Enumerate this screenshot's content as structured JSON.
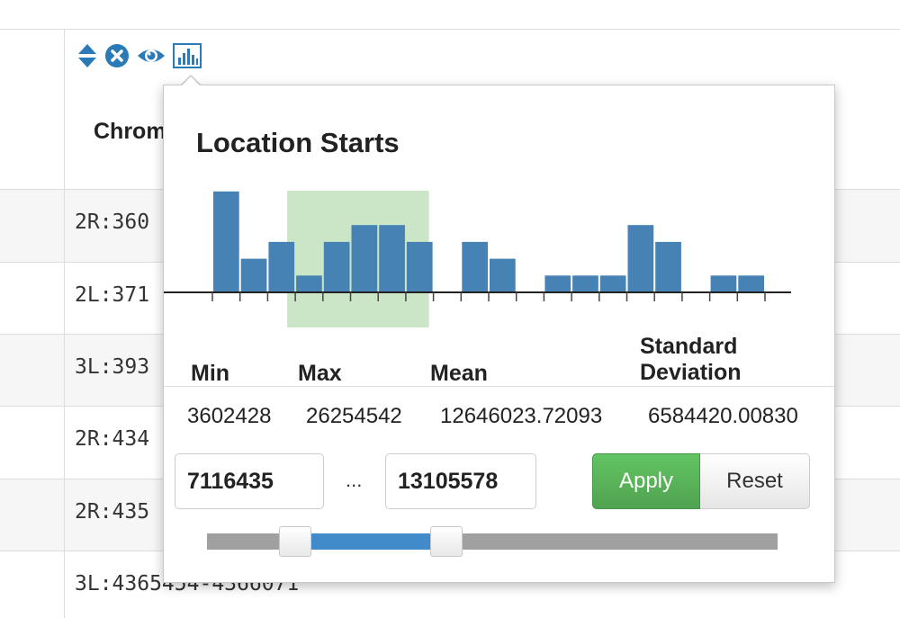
{
  "table": {
    "column_header": "Chrom",
    "rows": [
      "2R:360",
      "2L:371",
      "3L:393",
      "2R:434",
      "2R:435",
      "3L:4365454-4366071"
    ]
  },
  "icons": [
    "sort-icon",
    "remove-filter-icon",
    "eye-icon",
    "bar-chart-icon"
  ],
  "popover": {
    "title": "Location Starts",
    "stats": {
      "labels": {
        "min": "Min",
        "max": "Max",
        "mean": "Mean",
        "std": "Standard Deviation"
      },
      "values": {
        "min": "3602428",
        "max": "26254542",
        "mean": "12646023.72093",
        "std": "6584420.00830"
      }
    },
    "range": {
      "from": "7116435",
      "separator": "...",
      "to": "13105578"
    },
    "buttons": {
      "apply": "Apply",
      "reset": "Reset"
    },
    "slider": {
      "low_fraction": 0.155,
      "high_fraction": 0.42
    }
  },
  "chart_data": {
    "type": "bar",
    "bin_count": 20,
    "values": [
      6,
      2,
      3,
      1,
      3,
      4,
      4,
      3,
      0,
      3,
      2,
      0,
      1,
      1,
      1,
      4,
      3,
      0,
      1,
      1
    ],
    "selected_bins": [
      3,
      8
    ],
    "colors": {
      "bar": "#4682b4",
      "selection": "#a9d5a0",
      "axis": "#222222"
    }
  },
  "colors": {
    "apply_button": "#51a351",
    "slider_range": "#428bca",
    "icon_blue": "#2a7ab8"
  }
}
